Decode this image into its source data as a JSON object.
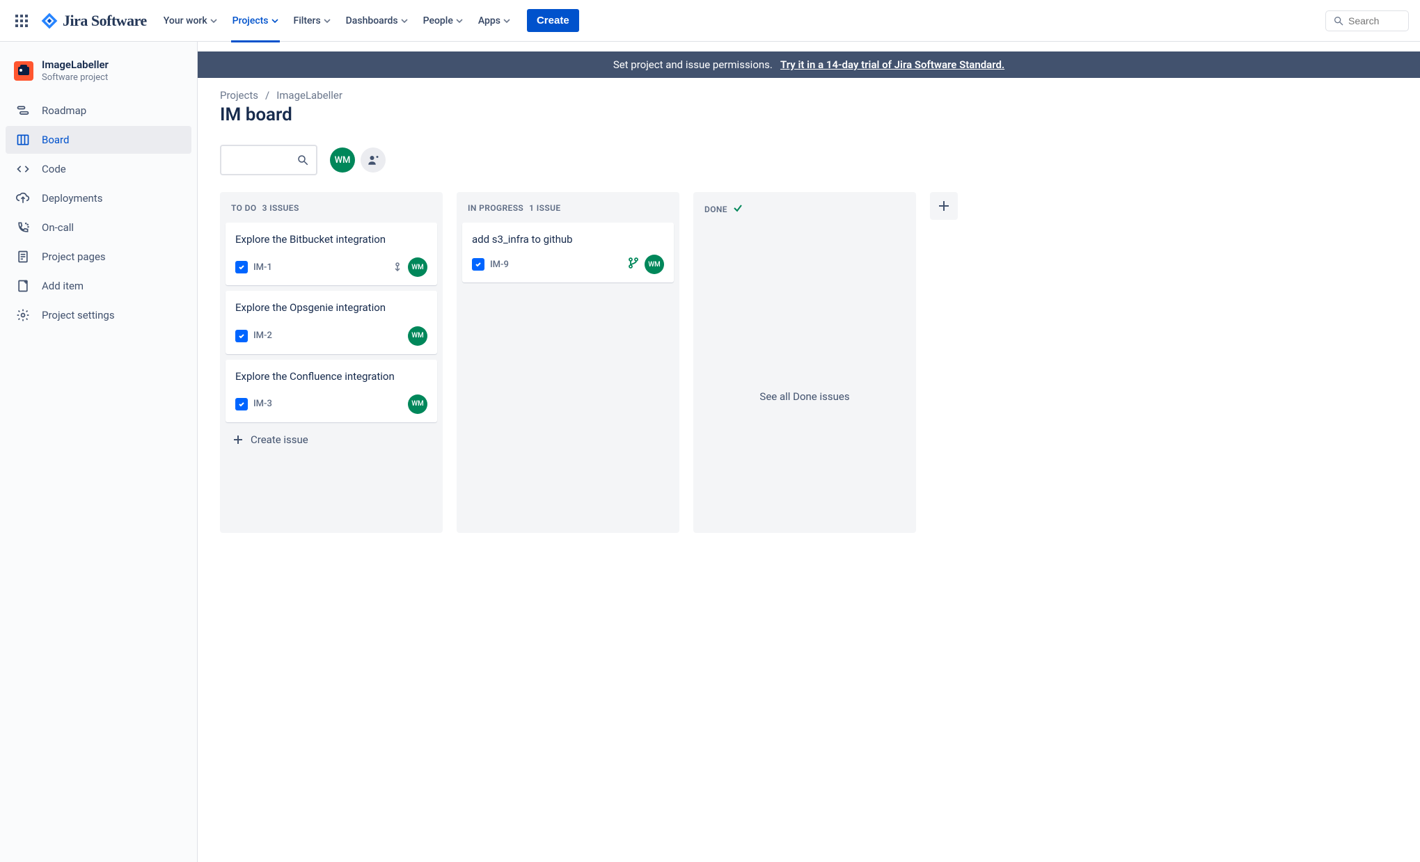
{
  "product_name": "Jira Software",
  "nav": {
    "your_work": "Your work",
    "projects": "Projects",
    "filters": "Filters",
    "dashboards": "Dashboards",
    "people": "People",
    "apps": "Apps",
    "create": "Create",
    "search_placeholder": "Search"
  },
  "banner": {
    "text": "Set project and issue permissions.",
    "link_text": "Try it in a 14-day trial of Jira Software Standard."
  },
  "project": {
    "name": "ImageLabeller",
    "type": "Software project"
  },
  "sidebar": {
    "items": [
      {
        "id": "roadmap",
        "label": "Roadmap"
      },
      {
        "id": "board",
        "label": "Board"
      },
      {
        "id": "code",
        "label": "Code"
      },
      {
        "id": "deployments",
        "label": "Deployments"
      },
      {
        "id": "oncall",
        "label": "On-call"
      },
      {
        "id": "pages",
        "label": "Project pages"
      },
      {
        "id": "add",
        "label": "Add item"
      },
      {
        "id": "settings",
        "label": "Project settings"
      }
    ]
  },
  "breadcrumbs": {
    "root": "Projects",
    "current": "ImageLabeller"
  },
  "board_title": "IM board",
  "toolbar": {
    "user_initials": "WM"
  },
  "columns": [
    {
      "name": "TO DO",
      "count_label": "3 ISSUES",
      "create_label": "Create issue",
      "cards": [
        {
          "title": "Explore the Bitbucket integration",
          "key": "IM-1",
          "assignee": "WM",
          "has_priority": true
        },
        {
          "title": "Explore the Opsgenie integration",
          "key": "IM-2",
          "assignee": "WM",
          "has_priority": false
        },
        {
          "title": "Explore the Confluence integration",
          "key": "IM-3",
          "assignee": "WM",
          "has_priority": false
        }
      ]
    },
    {
      "name": "IN PROGRESS",
      "count_label": "1 ISSUE",
      "cards": [
        {
          "title": "add s3_infra to github",
          "key": "IM-9",
          "assignee": "WM",
          "has_branch": true
        }
      ]
    },
    {
      "name": "DONE",
      "done": true,
      "body_text": "See all Done issues"
    }
  ]
}
